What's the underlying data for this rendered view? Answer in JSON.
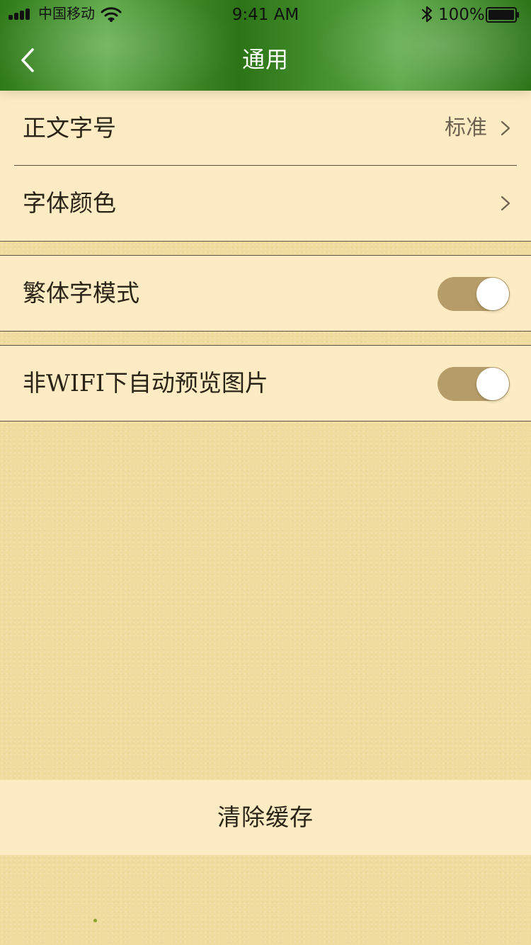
{
  "status_bar": {
    "carrier": "中国移动",
    "time": "9:41 AM",
    "battery_percent": "100%"
  },
  "navbar": {
    "title": "通用",
    "back_icon": "chevron-left-icon"
  },
  "settings": {
    "font_size": {
      "label": "正文字号",
      "value": "标准"
    },
    "font_color": {
      "label": "字体颜色"
    },
    "traditional_mode": {
      "label": "繁体字模式",
      "enabled": true
    },
    "auto_preview": {
      "label": "非WIFI下自动预览图片",
      "enabled": true
    }
  },
  "actions": {
    "clear_cache_label": "清除缓存"
  },
  "colors": {
    "nav_green": "#2f7a18",
    "cell_background": "#fdebc3",
    "page_background": "#f1dca0",
    "toggle_on": "#b59c68"
  }
}
